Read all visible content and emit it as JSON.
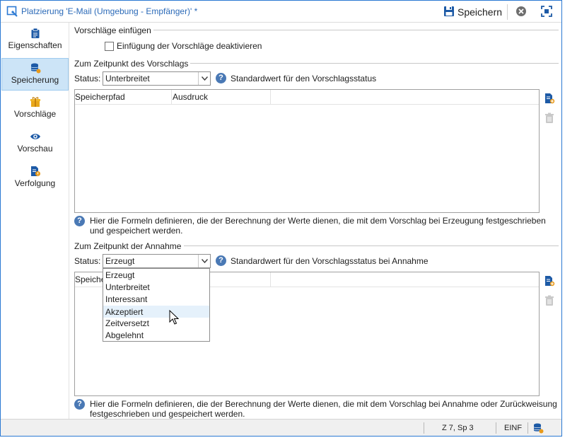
{
  "window": {
    "title": "Platzierung 'E-Mail (Umgebung - Empfänger)' *",
    "save_label": "Speichern"
  },
  "sidebar": {
    "items": [
      {
        "label": "Eigenschaften",
        "icon": "clipboard-icon",
        "active": false
      },
      {
        "label": "Speicherung",
        "icon": "database-icon",
        "active": true
      },
      {
        "label": "Vorschläge",
        "icon": "gift-icon",
        "active": false
      },
      {
        "label": "Vorschau",
        "icon": "eye-icon",
        "active": false
      },
      {
        "label": "Verfolgung",
        "icon": "tracking-icon",
        "active": false
      }
    ]
  },
  "insert_group": {
    "title": "Vorschläge einfügen",
    "checkbox_label": "Einfügung der Vorschläge deaktivieren",
    "checked": false
  },
  "proposal_group": {
    "title": "Zum Zeitpunkt des Vorschlags",
    "status_label": "Status:",
    "status_value": "Unterbreitet",
    "status_hint": "Standardwert für den Vorschlagsstatus",
    "columns": [
      "Speicherpfad",
      "Ausdruck"
    ],
    "info": "Hier die Formeln definieren, die der Berechnung der Werte dienen, die mit dem Vorschlag bei Erzeugung festgeschrieben und gespeichert werden."
  },
  "acceptance_group": {
    "title": "Zum Zeitpunkt der Annahme",
    "status_label": "Status:",
    "status_value": "Erzeugt",
    "status_hint": "Standardwert für den Vorschlagsstatus bei Annahme",
    "column_partial": "Speiche",
    "info": "Hier die Formeln definieren, die der Berechnung der Werte dienen, die mit dem Vorschlag bei Annahme oder Zurückweisung festgeschrieben und gespeichert werden."
  },
  "dropdown": {
    "options": [
      "Erzeugt",
      "Unterbreitet",
      "Interessant",
      "Akzeptiert",
      "Zeitversetzt",
      "Abgelehnt"
    ],
    "hovered": "Akzeptiert"
  },
  "statusbar": {
    "position": "Z 7, Sp 3",
    "mode": "EINF"
  },
  "colors": {
    "accent": "#2b79d3",
    "selection": "#cce4f7",
    "help": "#4a79b5"
  }
}
